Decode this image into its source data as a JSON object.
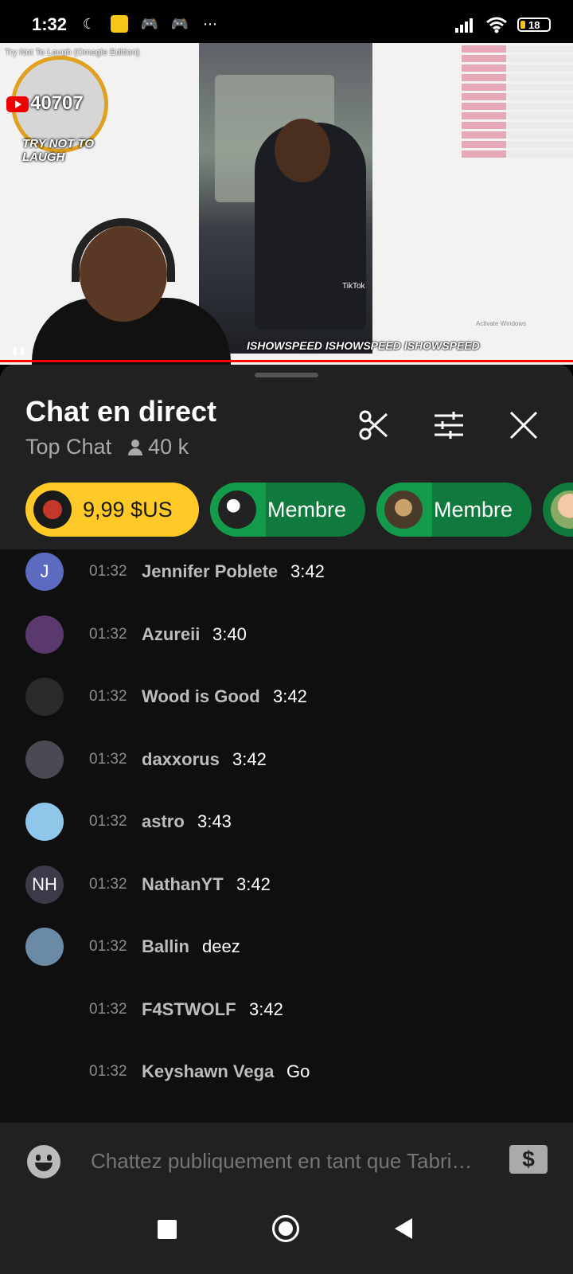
{
  "status_bar": {
    "time": "1:32",
    "battery": "18",
    "icons": [
      "moon-icon",
      "app-icon",
      "discord-icon",
      "discord-icon",
      "more-icon",
      "signal-icon",
      "wifi-icon",
      "battery-icon"
    ]
  },
  "video": {
    "title": "Try Not To Laugh (Omegle Edition)",
    "counter": "40707",
    "overlay_text": "TRY NOT TO LAUGH",
    "tiktok": "TikTok",
    "handles": [
      "ISHOWSPEED",
      "ISHOWSPEED",
      "ISHOWSPEED"
    ],
    "activate_windows": "Activate Windows",
    "progress_fraction": 0.02
  },
  "chat": {
    "title": "Chat en direct",
    "mode": "Top Chat",
    "viewers": "40 k",
    "chips": [
      {
        "label": "9,99 $US",
        "type": "paid"
      },
      {
        "label": "Membre",
        "type": "member"
      },
      {
        "label": "Membre",
        "type": "member"
      }
    ],
    "messages": [
      {
        "time": "01:32",
        "author": "Jennifer Poblete",
        "text": "3:42",
        "avatar_letter": "J",
        "avatar_color": "#5c6bc0"
      },
      {
        "time": "01:32",
        "author": "Azureii",
        "text": "3:40",
        "avatar_letter": "",
        "avatar_color": "#5a3a6e"
      },
      {
        "time": "01:32",
        "author": "Wood is Good",
        "text": "3:42",
        "avatar_letter": "",
        "avatar_color": "#2a2a2a"
      },
      {
        "time": "01:32",
        "author": "daxxorus",
        "text": "3:42",
        "avatar_letter": "",
        "avatar_color": "#4a4a55"
      },
      {
        "time": "01:32",
        "author": "astro",
        "text": "3:43",
        "avatar_letter": "",
        "avatar_color": "#8fc6ea"
      },
      {
        "time": "01:32",
        "author": "NathanYT",
        "text": "3:42",
        "avatar_letter": "NH",
        "avatar_color": "#3a3a48"
      },
      {
        "time": "01:32",
        "author": "Ballin",
        "text": "deez",
        "avatar_letter": "",
        "avatar_color": "#6a8aa5"
      },
      {
        "time": "01:32",
        "author": "F4STWOLF",
        "text": "3:42",
        "avatar_letter": "",
        "avatar_color": ""
      },
      {
        "time": "01:32",
        "author": "Keyshawn Vega",
        "text": "Go",
        "avatar_letter": "",
        "avatar_color": ""
      }
    ],
    "input_placeholder": "Chattez publiquement en tant que Tabri…"
  },
  "colors": {
    "accent_red": "#ff0000",
    "paid_chip": "#ffca28",
    "member_chip": "#0f7a3c",
    "panel_bg": "#212121",
    "chat_bg": "#0f0f0f"
  }
}
